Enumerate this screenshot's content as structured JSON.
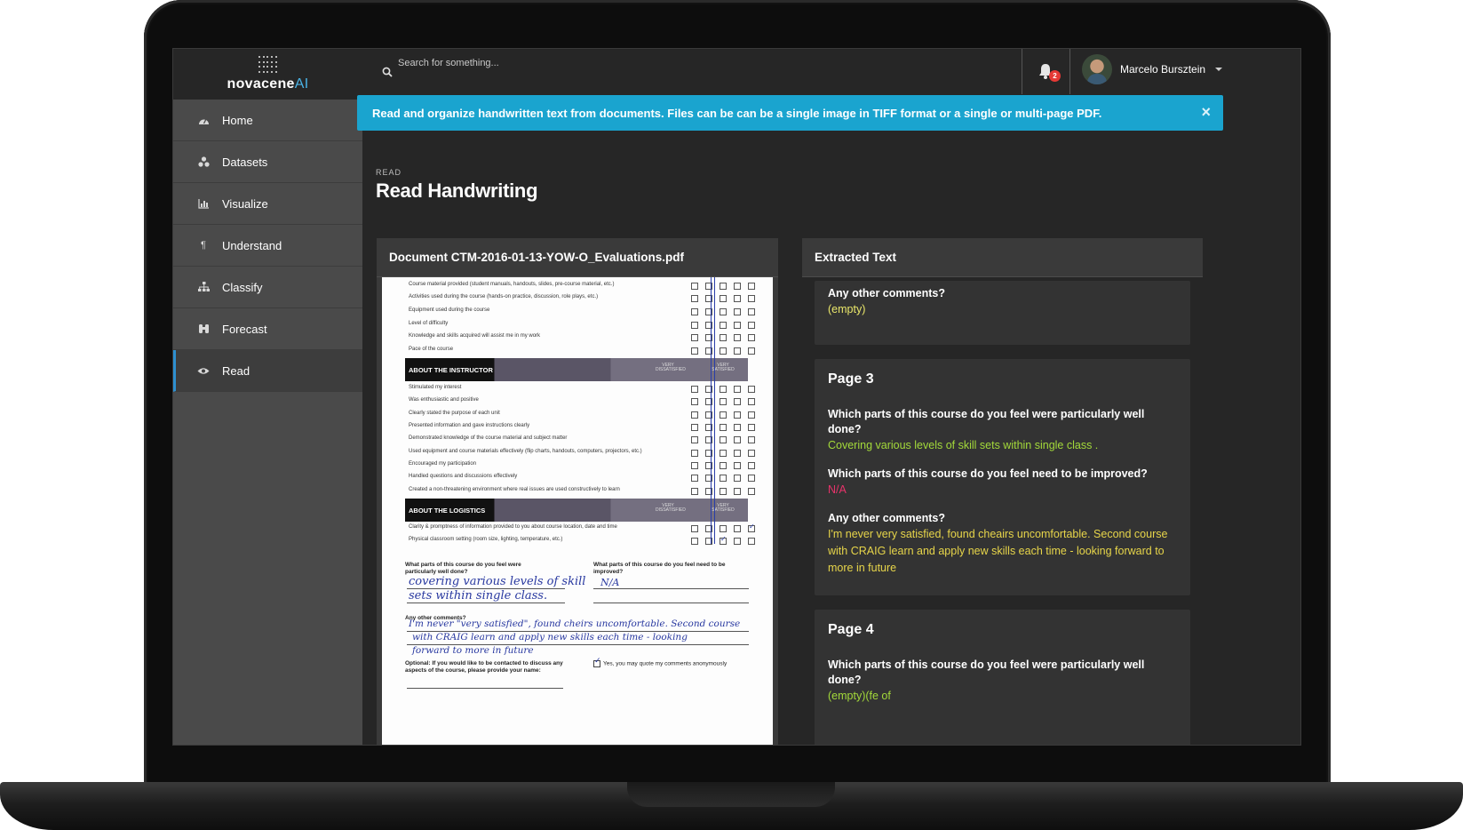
{
  "app": {
    "logo_text_main": "novacene",
    "logo_text_ai": "AI"
  },
  "sidebar": {
    "items": [
      {
        "label": "Home",
        "icon": "dashboard-icon"
      },
      {
        "label": "Datasets",
        "icon": "datasets-icon"
      },
      {
        "label": "Visualize",
        "icon": "bar-chart-icon"
      },
      {
        "label": "Understand",
        "icon": "paragraph-icon"
      },
      {
        "label": "Classify",
        "icon": "sitemap-icon"
      },
      {
        "label": "Forecast",
        "icon": "binoculars-icon"
      },
      {
        "label": "Read",
        "icon": "eye-icon",
        "active": true
      }
    ]
  },
  "topbar": {
    "search_placeholder": "Search for something...",
    "notification_count": "2",
    "user_name": "Marcelo Bursztein"
  },
  "banner": {
    "text": "Read and organize handwritten text from documents. Files can be can be a single image in TIFF format or a single or multi-page PDF.",
    "close_label": "×",
    "color": "#1aa4cf"
  },
  "header": {
    "eyebrow": "READ",
    "title": "Read Handwriting"
  },
  "document_panel": {
    "title": "Document CTM-2016-01-13-YOW-O_Evaluations.pdf",
    "course_rows": [
      "Course material provided (student manuals, handouts, slides, pre-course material, etc.)",
      "Activities used during the course (hands-on practice, discussion, role plays, etc.)",
      "Equipment used during the course",
      "Level of difficulty",
      "Knowledge and skills acquired will assist me in my work",
      "Pace of the course"
    ],
    "instructor_section": "ABOUT THE INSTRUCTOR",
    "instructor_rows": [
      "Stimulated my interest",
      "Was enthusiastic and positive",
      "Clearly stated the purpose of each unit",
      "Presented information and gave instructions clearly",
      "Demonstrated knowledge of the course material and subject matter",
      "Used equipment and course materials effectively (flip charts, handouts, computers, projectors, etc.)",
      "Encouraged my participation",
      "Handled questions and discussions effectively",
      "Created a non-threatening environment where real issues are used constructively to learn"
    ],
    "logistics_section": "ABOUT THE LOGISTICS",
    "logistics_rows": [
      "Clarity & promptness of information provided to you about course location, date and time",
      "Physical classroom setting (room size, lighting, temperature, etc.)"
    ],
    "scale_low": "VERY DISSATISFIED",
    "scale_high": "VERY SATISFIED",
    "q_well_done": "What parts of this course do you feel were particularly well done?",
    "q_improved": "What parts of this course do you feel need to be improved?",
    "q_comments": "Any other comments?",
    "q_optional": "Optional: If you would like to be contacted to discuss any aspects of the course, please provide your name:",
    "anon_label": "Yes, you may quote my comments anonymously",
    "hw_well_done_1": "covering various levels of skill",
    "hw_well_done_2": "sets within single class.",
    "hw_improved": "N/A",
    "hw_comments_1": "I'm never \"very satisfied\", found cheirs uncomfortable. Second course",
    "hw_comments_2": "with CRAIG learn and apply new skills each time - looking",
    "hw_comments_3": "forward to more in future"
  },
  "text_panel": {
    "title": "Extracted Text",
    "top_card": {
      "question": "Any other comments?",
      "answer": "(empty)"
    },
    "page3": {
      "title": "Page 3",
      "q1": "Which parts of this course do you feel were particularly well done?",
      "a1": "Covering various levels of skill sets within single class .",
      "q2": "Which parts of this course do you feel need to be improved?",
      "a2": "N/A",
      "q3": "Any other comments?",
      "a3": "I'm never very satisfied, found cheairs uncomfortable. Second course with CRAIG learn and apply new skills each time - looking forward to more in future"
    },
    "page4": {
      "title": "Page 4",
      "q1": "Which parts of this course do you feel were particularly well done?",
      "a1": "(empty)(fe of"
    }
  }
}
